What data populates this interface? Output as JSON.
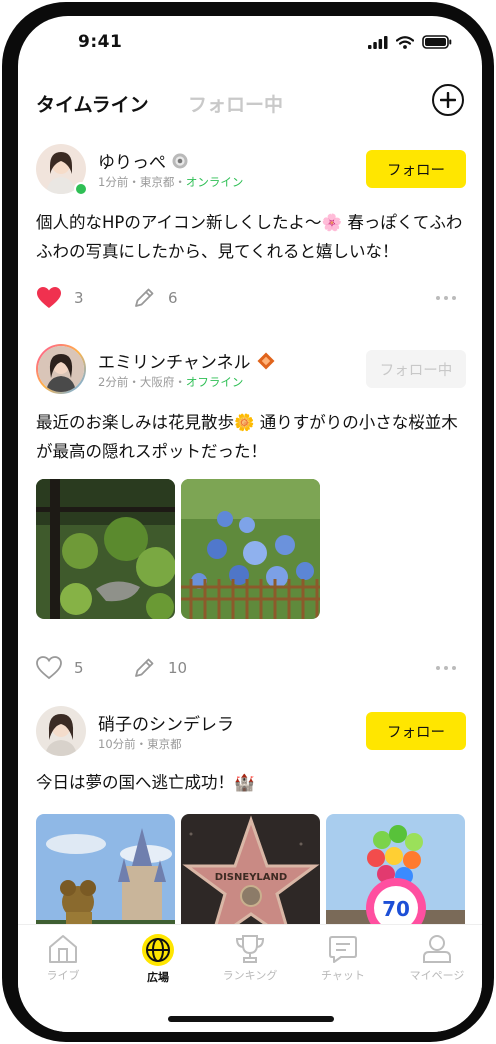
{
  "status": {
    "time": "9:41"
  },
  "header": {
    "tab_active": "タイムライン",
    "tab_inactive": "フォロー中"
  },
  "posts": [
    {
      "username": "ゆりっぺ",
      "meta_time": "1分前・東京都・",
      "meta_status": "オンライン",
      "follow_label": "フォロー",
      "text": "個人的なHPのアイコン新しくしたよ〜🌸 春っぽくてふわふわの写真にしたから、見てくれると嬉しいな！",
      "likes": "3",
      "comments": "6"
    },
    {
      "username": "エミリンチャンネル",
      "meta_time": "2分前・大阪府・",
      "meta_status": "オフライン",
      "follow_label": "フォロー中",
      "text": "最近のお楽しみは花見散歩🌼 通りすがりの小さな桜並木が最高の隠れスポットだった！",
      "likes": "5",
      "comments": "10"
    },
    {
      "username": "硝子のシンデレラ",
      "meta_time": "10分前・東京都",
      "follow_label": "フォロー",
      "text": "今日は夢の国へ逃亡成功！🏰",
      "star_text": "DISNEYLAND",
      "balloon_number": "70"
    }
  ],
  "nav": {
    "items": [
      {
        "label": "ライブ",
        "icon": "house-icon"
      },
      {
        "label": "広場",
        "icon": "globe-icon"
      },
      {
        "label": "ランキング",
        "icon": "trophy-icon"
      },
      {
        "label": "チャット",
        "icon": "chat-icon"
      },
      {
        "label": "マイページ",
        "icon": "person-icon"
      }
    ]
  },
  "colors": {
    "accent_yellow": "#ffe600",
    "online_green": "#2fbf55",
    "like_red": "#f0314f"
  }
}
